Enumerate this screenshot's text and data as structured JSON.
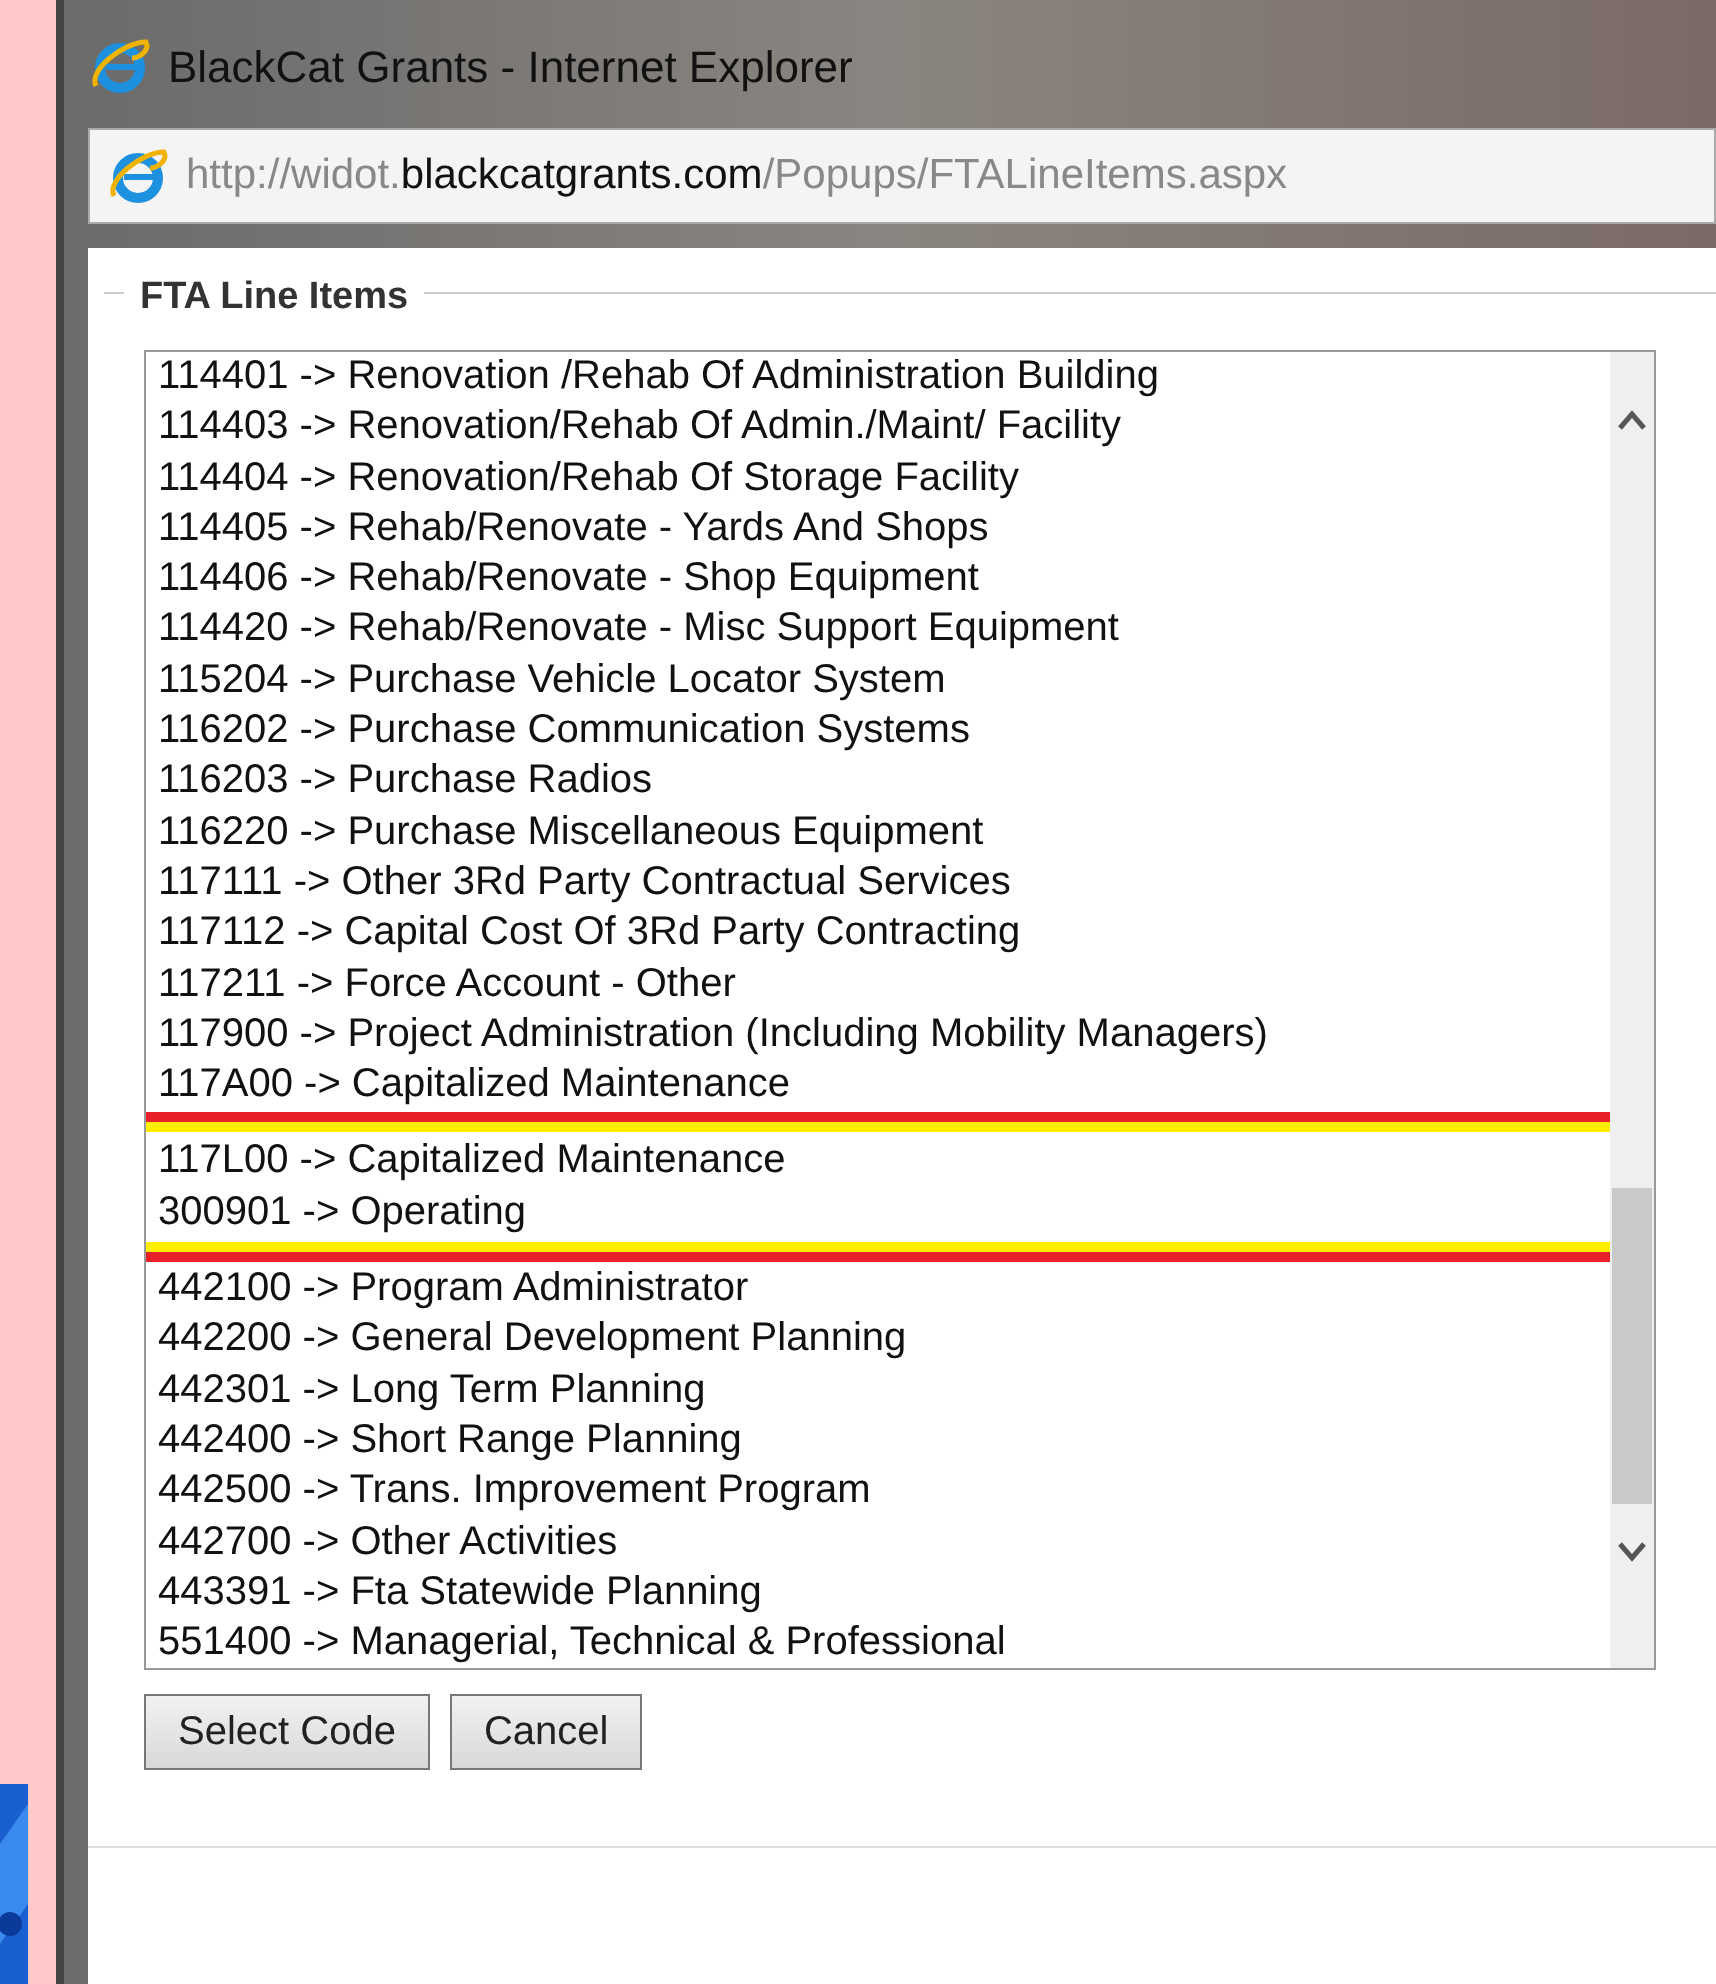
{
  "window": {
    "title": "BlackCat Grants - Internet Explorer"
  },
  "address_bar": {
    "url_prefix": "http://widot.",
    "url_domain": "blackcatgrants.com",
    "url_path": "/Popups/FTALineItems.aspx"
  },
  "fieldset": {
    "legend": "FTA Line Items"
  },
  "list": {
    "items": [
      {
        "label": "114401 -> Renovation /Rehab Of Administration Building",
        "highlighted": false
      },
      {
        "label": "114403 -> Renovation/Rehab Of Admin./Maint/ Facility",
        "highlighted": false
      },
      {
        "label": "114404 -> Renovation/Rehab Of Storage Facility",
        "highlighted": false
      },
      {
        "label": "114405 -> Rehab/Renovate - Yards And Shops",
        "highlighted": false
      },
      {
        "label": "114406 -> Rehab/Renovate - Shop Equipment",
        "highlighted": false
      },
      {
        "label": "114420 -> Rehab/Renovate - Misc Support Equipment",
        "highlighted": false
      },
      {
        "label": "115204 -> Purchase Vehicle Locator System",
        "highlighted": false
      },
      {
        "label": "116202 -> Purchase Communication Systems",
        "highlighted": false
      },
      {
        "label": "116203 -> Purchase Radios",
        "highlighted": false
      },
      {
        "label": "116220 -> Purchase Miscellaneous Equipment",
        "highlighted": false
      },
      {
        "label": "117111 -> Other 3Rd Party Contractual Services",
        "highlighted": false
      },
      {
        "label": "117112 -> Capital Cost Of 3Rd Party Contracting",
        "highlighted": false
      },
      {
        "label": "117211 -> Force Account - Other",
        "highlighted": false
      },
      {
        "label": "117900 -> Project Administration (Including Mobility Managers)",
        "highlighted": false
      },
      {
        "label": "117A00 -> Capitalized Maintenance",
        "highlighted": false
      },
      {
        "label": "117L00 -> Capitalized Maintenance",
        "highlighted": true
      },
      {
        "label": "300901 -> Operating",
        "highlighted": true
      },
      {
        "label": "442100 -> Program Administrator",
        "highlighted": false
      },
      {
        "label": "442200 -> General Development Planning",
        "highlighted": false
      },
      {
        "label": "442301 -> Long Term Planning",
        "highlighted": false
      },
      {
        "label": "442400 -> Short Range Planning",
        "highlighted": false
      },
      {
        "label": "442500 -> Trans. Improvement Program",
        "highlighted": false
      },
      {
        "label": "442700 -> Other Activities",
        "highlighted": false
      },
      {
        "label": "443391 -> Fta Statewide Planning",
        "highlighted": false
      },
      {
        "label": "551400 -> Managerial, Technical & Professional",
        "highlighted": false
      }
    ]
  },
  "buttons": [
    "Select Code",
    "Cancel"
  ]
}
